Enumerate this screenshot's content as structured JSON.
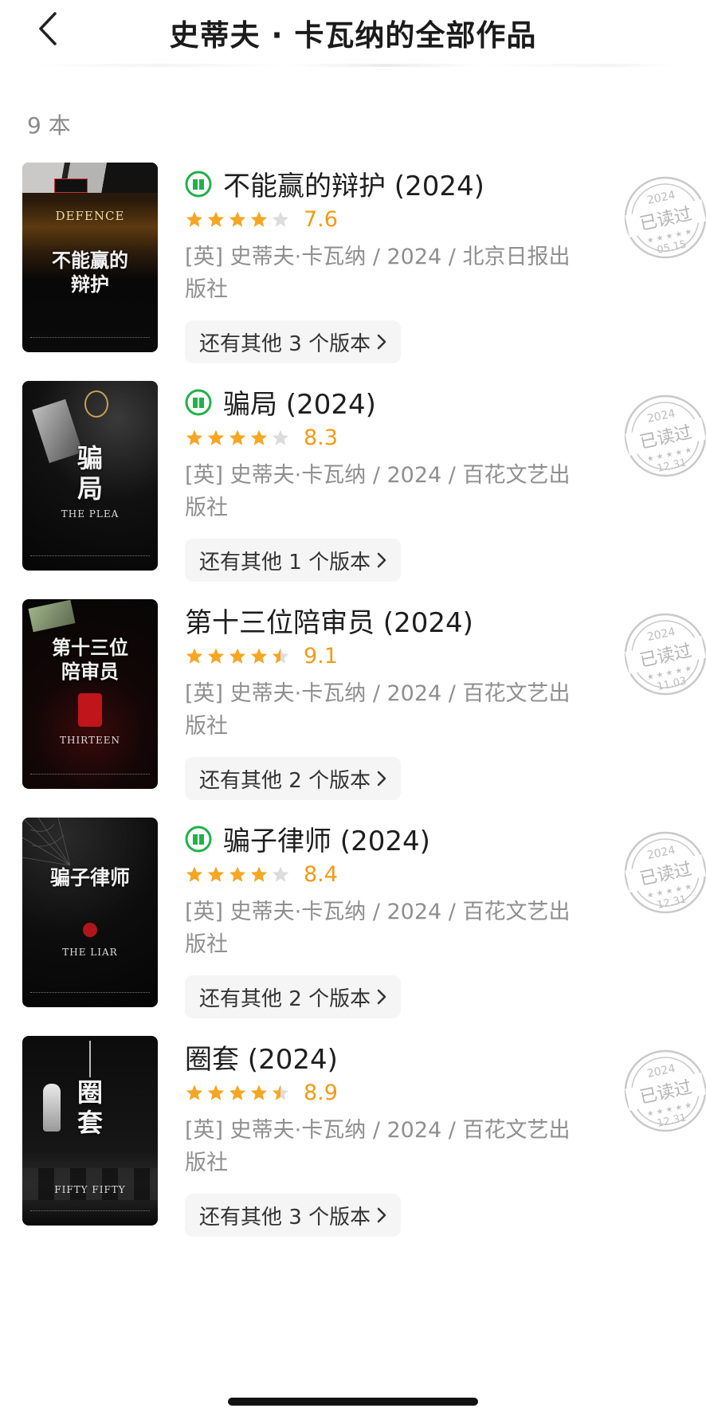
{
  "header": {
    "title": "史蒂夫 · 卡瓦纳的全部作品"
  },
  "count": "9 本",
  "books": [
    {
      "title": "不能赢的辩护 (2024)",
      "rating": "7.6",
      "stars": 4,
      "read_icon": true,
      "author_publisher": "[英] 史蒂夫·卡瓦纳 / 2024 / 北京日报出版社",
      "editions": "还有其他 3 个版本",
      "cover": {
        "title": "不能赢的\n辩护",
        "subtitle": "DEFENCE"
      },
      "stamp": {
        "year": "2024",
        "label": "已读过",
        "date": "05.15"
      }
    },
    {
      "title": "骗局 (2024)",
      "rating": "8.3",
      "stars": 4,
      "read_icon": true,
      "author_publisher": "[英] 史蒂夫·卡瓦纳 / 2024 / 百花文艺出版社",
      "editions": "还有其他 1 个版本",
      "cover": {
        "title": "骗\n局",
        "subtitle": "THE PLEA"
      },
      "stamp": {
        "year": "2024",
        "label": "已读过",
        "date": "12.31"
      }
    },
    {
      "title": "第十三位陪审员 (2024)",
      "rating": "9.1",
      "stars": 4.5,
      "read_icon": false,
      "author_publisher": "[英] 史蒂夫·卡瓦纳 / 2024 / 百花文艺出版社",
      "editions": "还有其他 2 个版本",
      "cover": {
        "title": "第十三位\n陪审员",
        "subtitle": "THIRTEEN"
      },
      "stamp": {
        "year": "2024",
        "label": "已读过",
        "date": "11.03"
      }
    },
    {
      "title": "骗子律师 (2024)",
      "rating": "8.4",
      "stars": 4,
      "read_icon": true,
      "author_publisher": "[英] 史蒂夫·卡瓦纳 / 2024 / 百花文艺出版社",
      "editions": "还有其他 2 个版本",
      "cover": {
        "title": "骗子律师",
        "subtitle": "THE LIAR"
      },
      "stamp": {
        "year": "2024",
        "label": "已读过",
        "date": "12.31"
      }
    },
    {
      "title": "圈套 (2024)",
      "rating": "8.9",
      "stars": 4.5,
      "read_icon": false,
      "author_publisher": "[英] 史蒂夫·卡瓦纳 / 2024 / 百花文艺出版社",
      "editions": "还有其他 3 个版本",
      "cover": {
        "title": "圈\n套",
        "subtitle": "FIFTY FIFTY"
      },
      "stamp": {
        "year": "2024",
        "label": "已读过",
        "date": "12.31"
      }
    }
  ],
  "colors": {
    "star": "#f5a623",
    "star_empty": "#dcdcdc",
    "rating": "#f29a16",
    "read_icon": "#21b14a",
    "stamp": "#c9c9c9"
  }
}
